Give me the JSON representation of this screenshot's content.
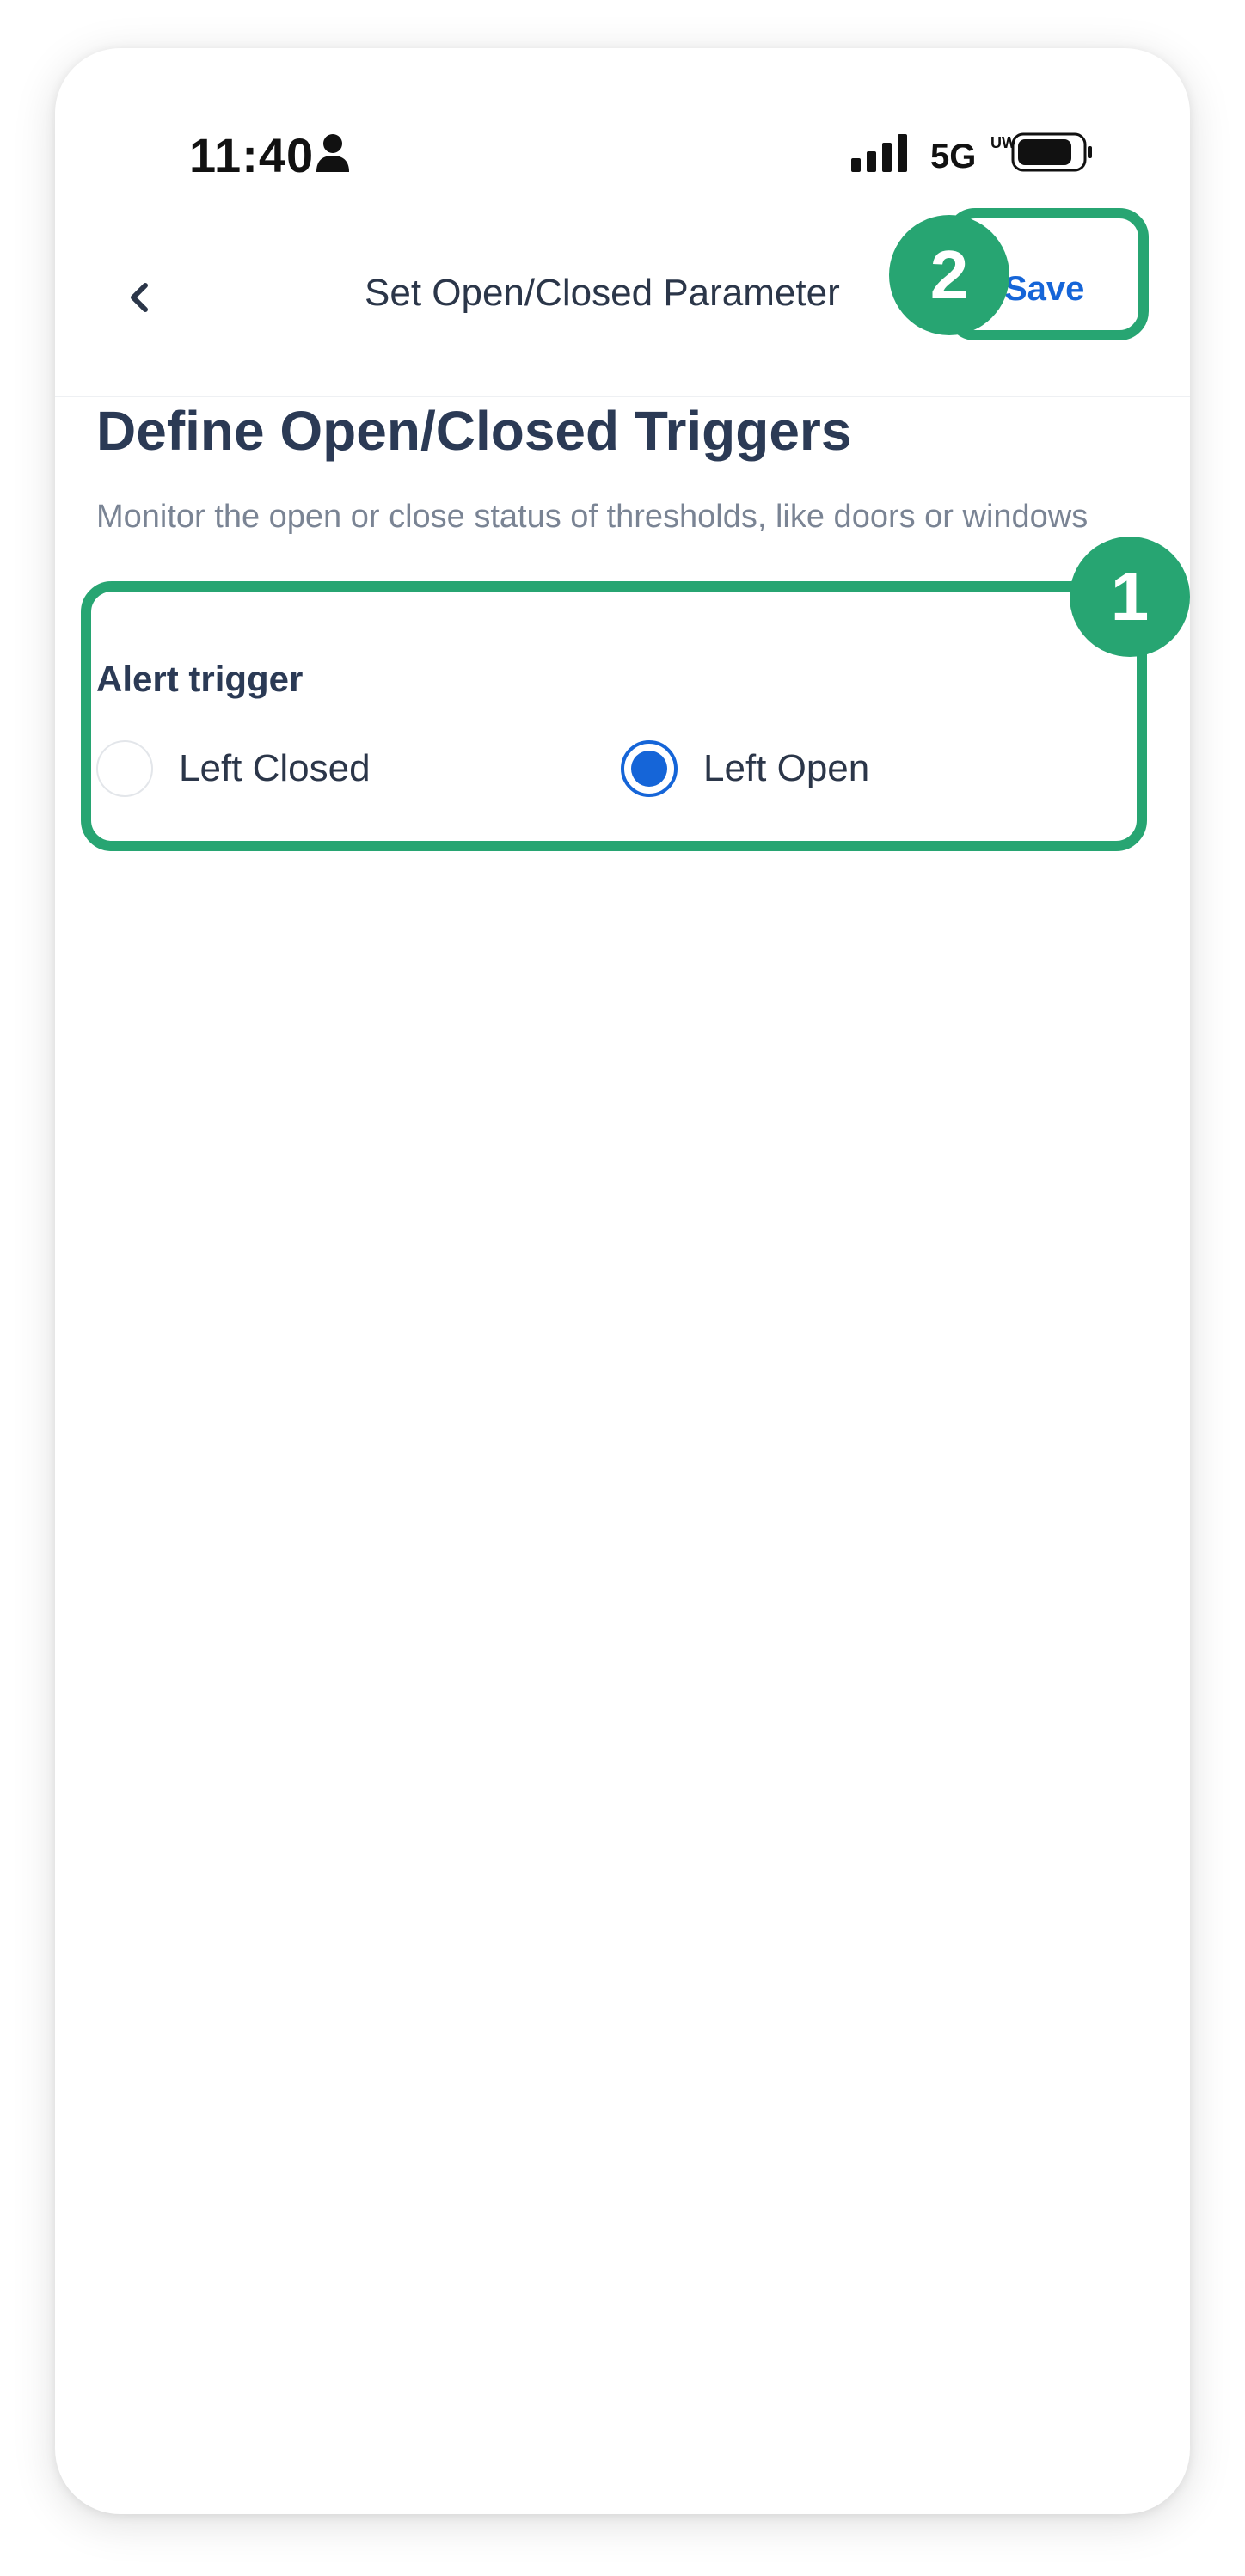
{
  "status_bar": {
    "time": "11:40",
    "network": "5G",
    "network_superscript": "UW",
    "icons": [
      "person-icon",
      "signal-icon",
      "battery-icon"
    ]
  },
  "nav": {
    "back_icon": "chevron-left-icon",
    "title": "Set Open/Closed Parameter",
    "save_label": "Save"
  },
  "content": {
    "heading": "Define Open/Closed Triggers",
    "subtitle": "Monitor the open or close status of thresholds, like doors or windows",
    "alert_trigger": {
      "label": "Alert trigger",
      "options": [
        {
          "label": "Left Closed",
          "selected": false
        },
        {
          "label": "Left Open",
          "selected": true
        }
      ]
    }
  },
  "annotations": {
    "badge_1": "1",
    "badge_2": "2",
    "color": "#27a572"
  },
  "colors": {
    "accent": "#1565d8",
    "heading": "#2b3a55",
    "muted": "#7a8494"
  }
}
